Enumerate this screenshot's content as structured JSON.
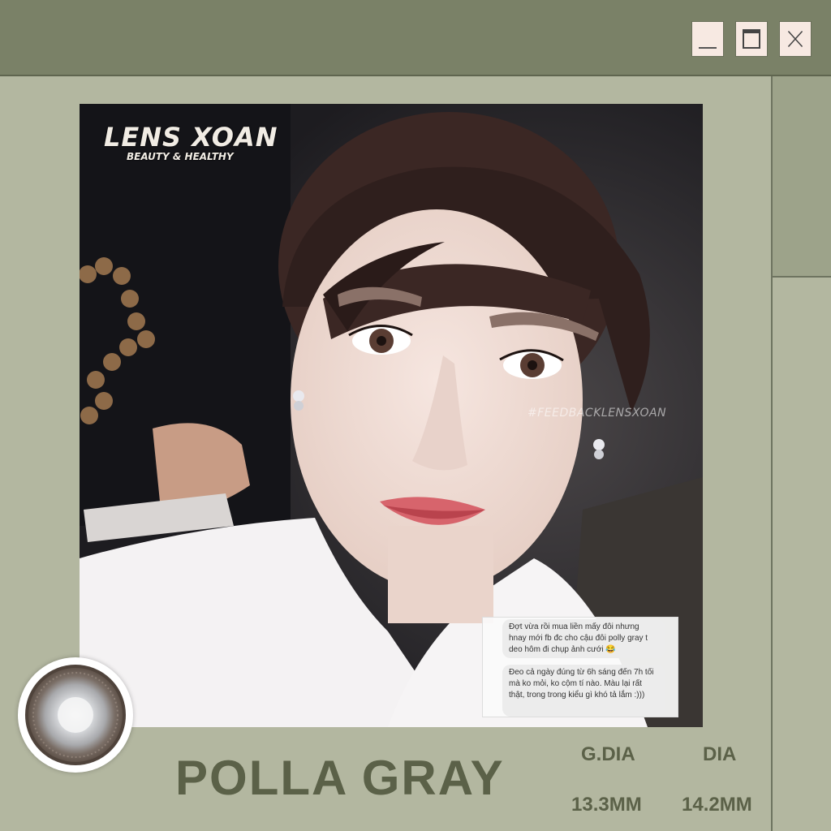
{
  "window": {
    "minimize_icon": "minimize-icon",
    "maximize_icon": "maximize-icon",
    "close_icon": "close-icon"
  },
  "brand": {
    "name": "LENS XOAN",
    "tagline": "BEAUTY & HEALTHY"
  },
  "hashtag": "#FEEDBACKLENSXOAN",
  "chat": {
    "message_1": "Đợt vừa rồi mua liền mấy đôi nhưng hnay mới fb đc cho cậu đôi polly gray t deo hôm đi chụp ảnh cưới 😂",
    "message_2": "Đeo cả ngày đúng từ 6h sáng đến 7h tối mà ko mỏi, ko cộm tí nào. Màu lại rất thật, trong trong kiểu gì khó tả lắm :)))"
  },
  "product": {
    "title": "POLLA GRAY",
    "gdia_label": "G.DIA",
    "dia_label": "DIA",
    "gdia_value": "13.3MM",
    "dia_value": "14.2MM"
  },
  "colors": {
    "title_bar": "#7a8167",
    "background": "#b3b7a0",
    "text": "#5b6148",
    "button": "#f7e9e2"
  }
}
